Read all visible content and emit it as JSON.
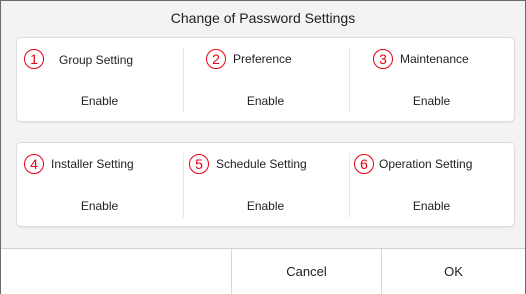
{
  "dialog": {
    "title": "Change of Password Settings"
  },
  "accent_color": "#e60012",
  "settings": [
    {
      "number": "1",
      "label": "Group Setting",
      "value": "Enable"
    },
    {
      "number": "2",
      "label": "Preference",
      "value": "Enable"
    },
    {
      "number": "3",
      "label": "Maintenance",
      "value": "Enable"
    },
    {
      "number": "4",
      "label": "Installer Setting",
      "value": "Enable"
    },
    {
      "number": "5",
      "label": "Schedule Setting",
      "value": "Enable"
    },
    {
      "number": "6",
      "label": "Operation Setting",
      "value": "Enable"
    }
  ],
  "footer": {
    "cancel_label": "Cancel",
    "ok_label": "OK"
  }
}
